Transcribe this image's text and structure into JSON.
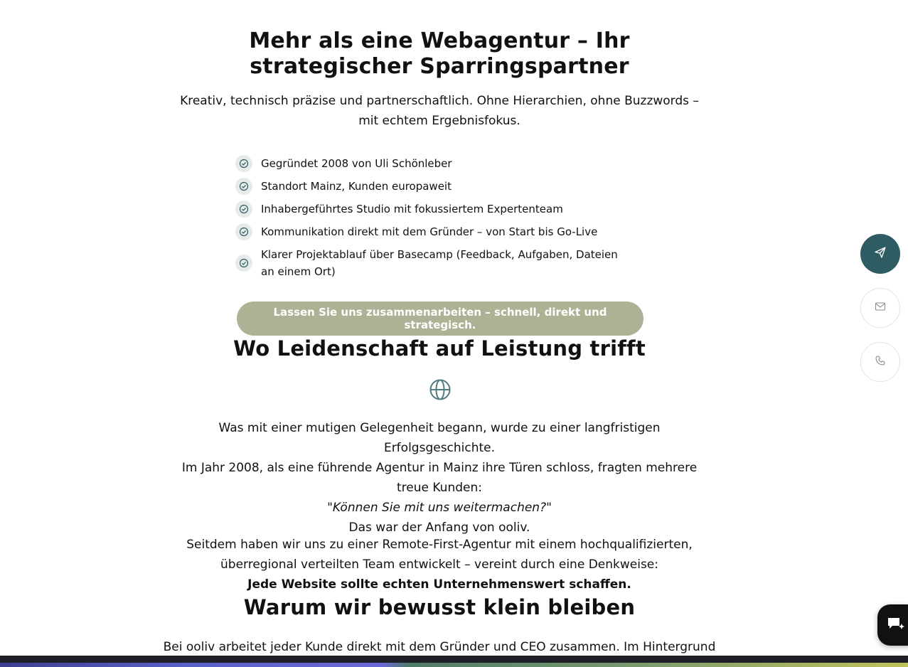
{
  "hero": {
    "title": "Mehr als eine Webagentur – Ihr strategischer Sparringspartner",
    "intro": "Kreativ, technisch präzise und partnerschaftlich. Ohne Hierarchien, ohne Buzzwords – mit echtem Ergebnisfokus."
  },
  "features": [
    "Gegründet 2008 von Uli Schönleber",
    "Standort Mainz, Kunden europaweit",
    "Inhabergeführtes Studio mit fokussiertem Expertenteam",
    "Kommunikation direkt mit dem Gründer – von Start bis Go-Live",
    "Klarer Projektablauf über Basecamp (Feedback, Aufgaben, Dateien an einem Ort)"
  ],
  "cta": {
    "label": "Lassen Sie uns zusammenarbeiten – schnell, direkt und strategisch."
  },
  "section_passion": {
    "title": "Wo Leidenschaft auf Leistung trifft",
    "icon": "globe-icon",
    "line1": "Was mit einer mutigen Gelegenheit begann, wurde zu einer langfristigen Erfolgsgeschichte.",
    "line2": "Im Jahr 2008, als eine führende Agentur in Mainz ihre Türen schloss, fragten mehrere treue Kunden:",
    "quote": "\"Können Sie mit uns weitermachen?\"",
    "line3": "Das war der Anfang von ooliv.",
    "line4": "Seitdem haben wir uns zu einer Remote-First-Agentur mit einem hochqualifizierten, überregional verteilten Team entwickelt – vereint durch eine Denkweise:",
    "emphasis": "Jede Website sollte echten Unternehmenswert schaffen."
  },
  "section_small": {
    "title": "Warum wir bewusst klein bleiben",
    "text": "Bei ooliv arbeitet jeder Kunde direkt mit dem Gründer und CEO zusammen. Im Hintergrund"
  },
  "floating_actions": {
    "send_icon": "send-icon",
    "mail_icon": "mail-icon",
    "phone_icon": "phone-icon",
    "chat_icon": "chat-sparkle-icon"
  },
  "colors": {
    "cta_background": "#aeb295",
    "primary_action": "#2f5b62",
    "check_badge": "#e4ebe9"
  }
}
